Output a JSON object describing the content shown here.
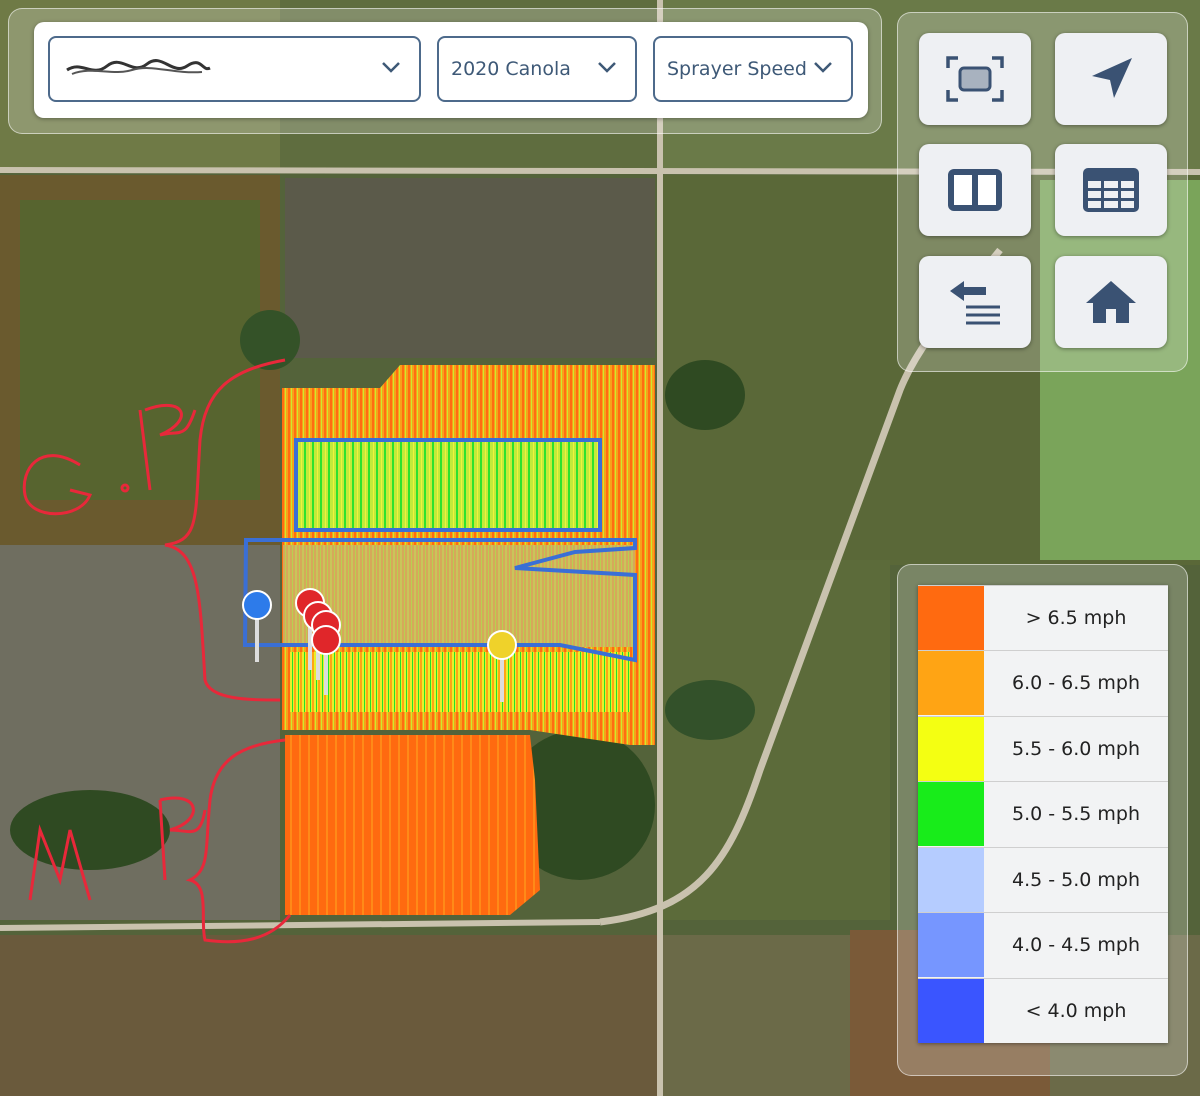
{
  "toolbar": {
    "farm_select": {
      "value": ""
    },
    "season_select": {
      "value": "2020 Canola"
    },
    "layer_select": {
      "value": "Sprayer Speed"
    }
  },
  "map_buttons": [
    {
      "name": "fit-bounds-icon"
    },
    {
      "name": "locate-arrow-icon"
    },
    {
      "name": "split-view-icon"
    },
    {
      "name": "table-icon"
    },
    {
      "name": "layers-back-icon"
    },
    {
      "name": "home-icon"
    }
  ],
  "legend": {
    "items": [
      {
        "label": "> 6.5 mph",
        "color": "#ff6a10"
      },
      {
        "label": "6.0 - 6.5 mph",
        "color": "#ffa414"
      },
      {
        "label": "5.5 - 6.0 mph",
        "color": "#f4ff12"
      },
      {
        "label": "5.0 - 5.5 mph",
        "color": "#18ec1a"
      },
      {
        "label": "4.5 - 5.0 mph",
        "color": "#b5ccff"
      },
      {
        "label": "4.0 - 4.5 mph",
        "color": "#7696ff"
      },
      {
        "label": "< 4.0 mph",
        "color": "#3a55ff"
      }
    ]
  },
  "annotations": {
    "upper": "G.R",
    "lower": "M.R"
  },
  "markers": [
    {
      "color": "#2d7bea"
    },
    {
      "color": "#e0262a"
    },
    {
      "color": "#e0262a"
    },
    {
      "color": "#e0262a"
    },
    {
      "color": "#e0262a"
    },
    {
      "color": "#efd22a"
    }
  ]
}
